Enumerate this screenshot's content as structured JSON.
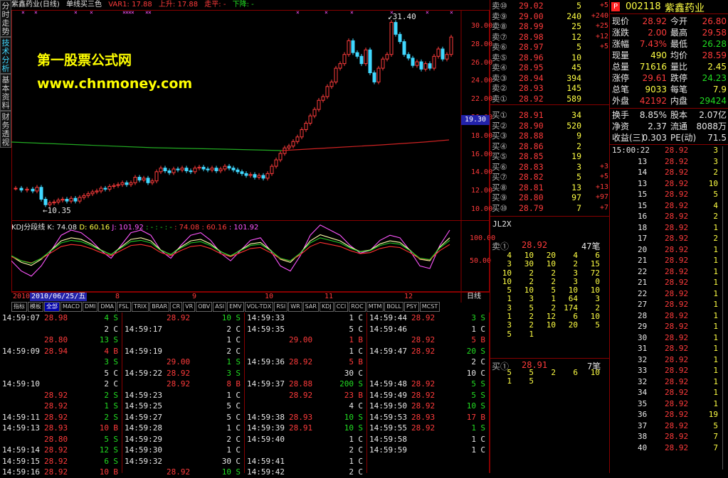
{
  "side_tabs": [
    "分时走势",
    "技术分析",
    "基本资料",
    "财务透视"
  ],
  "top_bar": {
    "title": "紫鑫药业(日线)",
    "mode": "单线买三色",
    "var1": "VAR1: 17.88",
    "up": "上升: 17.88",
    "flat": "走平: -",
    "down": "下降: -"
  },
  "watermark": {
    "line1": "第一股票公式网",
    "line2": "www.chnmoney.com"
  },
  "price_axis": [
    "30.00",
    "28.00",
    "26.00",
    "24.00",
    "22.00",
    "20.00",
    "18.00",
    "16.00",
    "14.00",
    "12.00",
    "10.00"
  ],
  "price_marker": "19.30",
  "high_label": "31.40",
  "low_label": "10.35",
  "kdj": {
    "name": "KDJ分段线",
    "k": "K: 74.08",
    "d": "D: 60.16",
    "j": "J: 101.92",
    "dashes": ": - : - : -",
    "v1": ": 74.08",
    "v2": ": 60.16",
    "v3": ": 101.92",
    "axis": [
      "100.00",
      "50.00"
    ]
  },
  "date_bar": {
    "year": "2010",
    "date": "2010/06/25/五",
    "months": [
      "8",
      "9",
      "10",
      "11",
      "12"
    ],
    "period": "日线"
  },
  "indicator_tabs": [
    "指标",
    "模板",
    "全部",
    "MACD",
    "DMI",
    "DMA",
    "FSL",
    "TRIX",
    "BRAR",
    "CR",
    "VR",
    "OBV",
    "ASI",
    "EMV",
    "VOL-TDX",
    "RSI",
    "WR",
    "SAR",
    "KDJ",
    "CCI",
    "ROC",
    "MTM",
    "BOLL",
    "PSY",
    "MCST"
  ],
  "tick_columns": [
    [
      [
        "14:59:07",
        "28.98",
        "4",
        "S"
      ],
      [
        "",
        "",
        "2",
        "C"
      ],
      [
        "",
        "28.80",
        "13",
        "S"
      ],
      [
        "14:59:09",
        "28.94",
        "4",
        "B"
      ],
      [
        "",
        "",
        "3",
        "S"
      ],
      [
        "",
        "",
        "5",
        "C"
      ],
      [
        "14:59:10",
        "",
        "2",
        "C"
      ],
      [
        "",
        "28.92",
        "2",
        "S"
      ],
      [
        "",
        "28.92",
        "1",
        "S"
      ],
      [
        "14:59:11",
        "28.92",
        "2",
        "S"
      ],
      [
        "14:59:13",
        "28.93",
        "10",
        "B"
      ],
      [
        "",
        "28.80",
        "5",
        "S"
      ],
      [
        "14:59:14",
        "28.92",
        "12",
        "S"
      ],
      [
        "14:59:15",
        "28.92",
        "6",
        "S"
      ],
      [
        "14:59:16",
        "28.92",
        "10",
        "B"
      ]
    ],
    [
      [
        "",
        "28.92",
        "10",
        "S"
      ],
      [
        "14:59:17",
        "",
        "2",
        "C"
      ],
      [
        "",
        "",
        "1",
        "C"
      ],
      [
        "14:59:19",
        "",
        "2",
        "C"
      ],
      [
        "",
        "29.00",
        "1",
        "S"
      ],
      [
        "14:59:22",
        "28.92",
        "3",
        "S"
      ],
      [
        "",
        "28.92",
        "8",
        "B"
      ],
      [
        "14:59:23",
        "",
        "1",
        "C"
      ],
      [
        "14:59:25",
        "",
        "5",
        "C"
      ],
      [
        "14:59:27",
        "",
        "5",
        "C"
      ],
      [
        "14:59:28",
        "",
        "1",
        "C"
      ],
      [
        "14:59:29",
        "",
        "2",
        "C"
      ],
      [
        "14:59:30",
        "",
        "1",
        "C"
      ],
      [
        "14:59:32",
        "",
        "30",
        "C"
      ],
      [
        "",
        "28.92",
        "10",
        "S"
      ]
    ],
    [
      [
        "14:59:33",
        "",
        "1",
        "C"
      ],
      [
        "14:59:35",
        "",
        "5",
        "C"
      ],
      [
        "",
        "29.00",
        "1",
        "B"
      ],
      [
        "",
        "",
        "1",
        "C"
      ],
      [
        "14:59:36",
        "28.92",
        "5",
        "B"
      ],
      [
        "",
        "",
        "30",
        "C"
      ],
      [
        "14:59:37",
        "28.88",
        "200",
        "S"
      ],
      [
        "",
        "28.92",
        "23",
        "B"
      ],
      [
        "",
        "",
        "4",
        "C"
      ],
      [
        "14:59:38",
        "28.93",
        "10",
        "S"
      ],
      [
        "14:59:39",
        "28.91",
        "10",
        "S"
      ],
      [
        "14:59:40",
        "",
        "1",
        "C"
      ],
      [
        "",
        "",
        "2",
        "C"
      ],
      [
        "14:59:41",
        "",
        "1",
        "C"
      ],
      [
        "14:59:42",
        "",
        "2",
        "C"
      ]
    ],
    [
      [
        "14:59:44",
        "28.92",
        "3",
        "S"
      ],
      [
        "14:59:46",
        "",
        "1",
        "C"
      ],
      [
        "",
        "28.92",
        "5",
        "B"
      ],
      [
        "14:59:47",
        "28.92",
        "20",
        "S"
      ],
      [
        "",
        "",
        "2",
        "C"
      ],
      [
        "",
        "",
        "10",
        "C"
      ],
      [
        "14:59:48",
        "28.92",
        "5",
        "S"
      ],
      [
        "14:59:49",
        "28.92",
        "5",
        "S"
      ],
      [
        "14:59:50",
        "28.92",
        "10",
        "S"
      ],
      [
        "14:59:53",
        "28.93",
        "17",
        "B"
      ],
      [
        "14:59:55",
        "28.92",
        "1",
        "S"
      ],
      [
        "14:59:58",
        "",
        "1",
        "C"
      ],
      [
        "14:59:59",
        "",
        "1",
        "C"
      ],
      [
        "",
        "",
        "",
        " "
      ],
      [
        "",
        "",
        "",
        " "
      ]
    ]
  ],
  "sell_book": [
    [
      "卖⑩",
      "29.02",
      "5",
      "+5"
    ],
    [
      "卖⑨",
      "29.00",
      "240",
      "+240"
    ],
    [
      "卖⑧",
      "28.99",
      "25",
      "+25"
    ],
    [
      "卖⑦",
      "28.98",
      "12",
      "+12"
    ],
    [
      "卖⑥",
      "28.97",
      "5",
      "+5"
    ],
    [
      "卖⑤",
      "28.96",
      "10",
      ""
    ],
    [
      "卖④",
      "28.95",
      "45",
      ""
    ],
    [
      "卖③",
      "28.94",
      "394",
      ""
    ],
    [
      "卖②",
      "28.93",
      "145",
      ""
    ],
    [
      "卖①",
      "28.92",
      "589",
      ""
    ]
  ],
  "buy_book": [
    [
      "买①",
      "28.91",
      "34",
      ""
    ],
    [
      "买②",
      "28.90",
      "520",
      ""
    ],
    [
      "买③",
      "28.88",
      "9",
      ""
    ],
    [
      "买④",
      "28.86",
      "2",
      ""
    ],
    [
      "买⑤",
      "28.85",
      "19",
      ""
    ],
    [
      "买⑥",
      "28.83",
      "3",
      "+3"
    ],
    [
      "买⑦",
      "28.82",
      "5",
      "+5"
    ],
    [
      "买⑧",
      "28.81",
      "13",
      "+13"
    ],
    [
      "买⑨",
      "28.80",
      "97",
      "+97"
    ],
    [
      "买⑩",
      "28.79",
      "7",
      "+7"
    ]
  ],
  "jl2x": "JL2X",
  "sell1_queue": {
    "label": "卖①",
    "price": "28.92",
    "count": "47笔",
    "rows": [
      [
        "4",
        "10",
        "20",
        "4",
        "6"
      ],
      [
        "3",
        "30",
        "10",
        "2",
        "15"
      ],
      [
        "10",
        "2",
        "2",
        "3",
        "72"
      ],
      [
        "10",
        "2",
        "2",
        "3",
        "0"
      ],
      [
        "5",
        "10",
        "5",
        "10",
        "10"
      ],
      [
        "1",
        "3",
        "1",
        "64",
        "3"
      ],
      [
        "3",
        "5",
        "2",
        "174",
        "2"
      ],
      [
        "1",
        "2",
        "12",
        "6",
        "10"
      ],
      [
        "3",
        "2",
        "10",
        "20",
        "5"
      ],
      [
        "5",
        "1",
        "",
        "",
        ""
      ]
    ]
  },
  "buy1_queue": {
    "label": "买①",
    "price": "28.91",
    "count": "7笔",
    "rows": [
      [
        "5",
        "5",
        "2",
        "6",
        "10"
      ],
      [
        "1",
        "5",
        "",
        "",
        ""
      ]
    ]
  },
  "stock": {
    "badge": "P",
    "code": "002118",
    "name": "紫鑫药业"
  },
  "stats": [
    [
      "现价",
      "28.92",
      "今开",
      "26.80"
    ],
    [
      "涨跌",
      "2.00",
      "最高",
      "29.58"
    ],
    [
      "涨幅",
      "7.43%",
      "最低",
      "26.28"
    ],
    [
      "现量",
      "490",
      "均价",
      "28.59"
    ],
    [
      "总量",
      "71616",
      "量比",
      "2.45"
    ],
    [
      "涨停",
      "29.61",
      "跌停",
      "24.23"
    ],
    [
      "总笔",
      "9033",
      "每笔",
      "7.9"
    ],
    [
      "外盘",
      "42192",
      "内盘",
      "29424"
    ]
  ],
  "stats2": [
    [
      "换手",
      "8.85%",
      "股本",
      "2.07亿"
    ],
    [
      "净资",
      "2.37",
      "流通",
      "8088万"
    ],
    [
      "收益(三)",
      "0.303",
      "PE(动)",
      "71.5"
    ]
  ],
  "trades": [
    [
      "15:00:22",
      "28.92",
      "3"
    ],
    [
      "13",
      "28.92",
      "3"
    ],
    [
      "14",
      "28.92",
      "2"
    ],
    [
      "13",
      "28.92",
      "10"
    ],
    [
      "15",
      "28.92",
      "5"
    ],
    [
      "15",
      "28.92",
      "4"
    ],
    [
      "16",
      "28.92",
      "2"
    ],
    [
      "18",
      "28.92",
      "1"
    ],
    [
      "17",
      "28.92",
      "2"
    ],
    [
      "20",
      "28.92",
      "1"
    ],
    [
      "21",
      "28.92",
      "1"
    ],
    [
      "22",
      "28.92",
      "1"
    ],
    [
      "21",
      "28.92",
      "1"
    ],
    [
      "22",
      "28.92",
      "1"
    ],
    [
      "27",
      "28.92",
      "1"
    ],
    [
      "28",
      "28.92",
      "1"
    ],
    [
      "29",
      "28.92",
      "1"
    ],
    [
      "30",
      "28.92",
      "1"
    ],
    [
      "31",
      "28.92",
      "1"
    ],
    [
      "32",
      "28.92",
      "1"
    ],
    [
      "33",
      "28.92",
      "1"
    ],
    [
      "32",
      "28.92",
      "1"
    ],
    [
      "34",
      "28.92",
      "1"
    ],
    [
      "35",
      "28.92",
      "1"
    ],
    [
      "36",
      "28.92",
      "19"
    ],
    [
      "37",
      "28.92",
      "5"
    ],
    [
      "38",
      "28.92",
      "7"
    ],
    [
      "40",
      "28.92",
      "7"
    ]
  ]
}
